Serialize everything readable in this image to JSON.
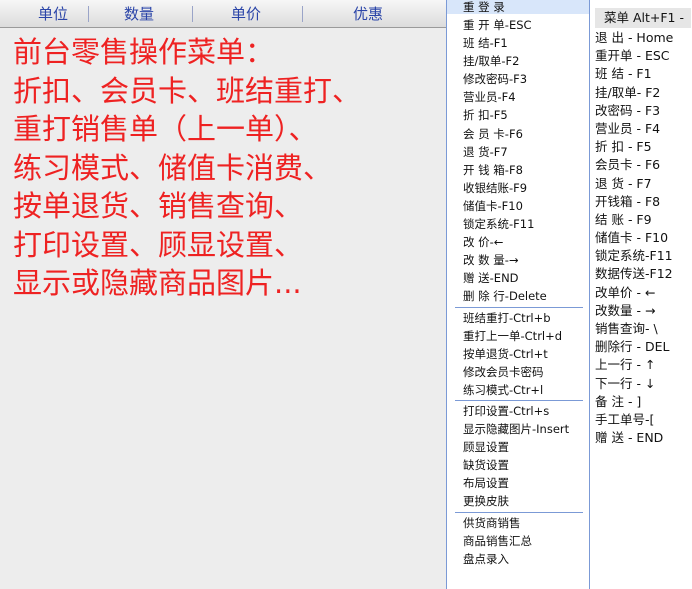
{
  "columns": [
    "单位",
    "数量",
    "单价",
    "优惠"
  ],
  "promo": [
    "前台零售操作菜单：",
    "折扣、会员卡、班结重打、",
    "重打销售单（上一单）、",
    "练习模式、储值卡消费、",
    "按单退货、销售查询、",
    "打印设置、顾显设置、",
    "显示或隐藏商品图片..."
  ],
  "menu": {
    "top_item": "重 登 录",
    "groups": [
      [
        "重 开 单-ESC",
        "班    结-F1",
        "挂/取单-F2",
        "修改密码-F3",
        "营业员-F4",
        "折    扣-F5",
        "会 员 卡-F6",
        "退    货-F7",
        "开 钱 箱-F8",
        "收银结账-F9",
        "储值卡-F10",
        "锁定系统-F11",
        "改    价-←",
        "改 数 量-→",
        "赠    送-END",
        "删 除 行-Delete"
      ],
      [
        "班结重打-Ctrl+b",
        "重打上一单-Ctrl+d",
        "按单退货-Ctrl+t",
        "修改会员卡密码",
        "练习模式-Ctr+l"
      ],
      [
        "打印设置-Ctrl+s",
        "显示隐藏图片-Insert",
        "顾显设置",
        "缺货设置",
        "布局设置",
        "更换皮肤"
      ],
      [
        "供货商销售",
        "商品销售汇总",
        "盘点录入"
      ]
    ]
  },
  "shortcuts": {
    "title": "菜单 Alt+F1 -",
    "items": [
      "退  出 - Home",
      "重开单 - ESC",
      "班  结 - F1",
      "挂/取单- F2",
      "改密码 - F3",
      "营业员 - F4",
      "折  扣 - F5",
      "会员卡 - F6",
      "退  货 - F7",
      "开钱箱 - F8",
      "结  账 - F9",
      "储值卡 - F10",
      "锁定系统-F11",
      "数据传送-F12",
      "改单价 - ←",
      "改数量 - →",
      "销售查询- \\",
      "删除行 - DEL",
      "上一行 - ↑",
      "下一行 - ↓",
      "备  注 - ]",
      "手工单号-[",
      "赠  送 - END"
    ]
  },
  "colors": {
    "promo_text": "#ee2222",
    "header_text": "#2a44a8",
    "menu_border": "#7b9ad6",
    "menu_highlight": "#d8e6fa"
  }
}
